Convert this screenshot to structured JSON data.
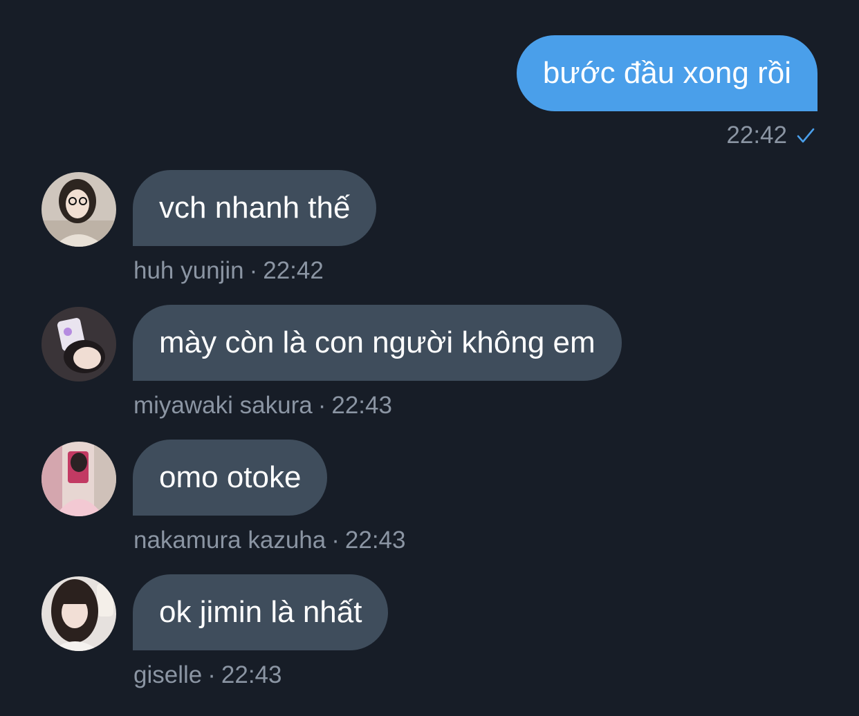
{
  "outgoing": {
    "text": "bước đầu xong rồi",
    "time": "22:42",
    "status_icon": "checkmark-icon"
  },
  "separator": "·",
  "messages": [
    {
      "sender": "huh yunjin",
      "text": "vch nhanh thế",
      "time": "22:42"
    },
    {
      "sender": "miyawaki sakura",
      "text": "mày còn là con người không em",
      "time": "22:43"
    },
    {
      "sender": "nakamura kazuha",
      "text": "omo otoke",
      "time": "22:43"
    },
    {
      "sender": "giselle",
      "text": "ok jimin là nhất",
      "time": "22:43"
    }
  ],
  "colors": {
    "background": "#171d27",
    "outgoing_bubble": "#4a9fea",
    "incoming_bubble": "#3f4d5c",
    "meta_text": "#8b95a3",
    "check": "#4a9fea"
  }
}
